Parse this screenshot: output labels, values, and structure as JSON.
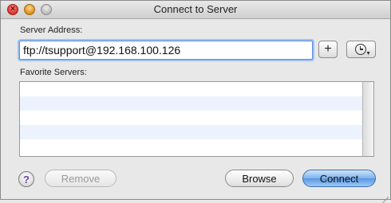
{
  "window": {
    "title": "Connect to Server"
  },
  "server_address": {
    "label": "Server Address:",
    "value": "ftp://tsupport@192.168.100.126"
  },
  "buttons": {
    "add": "+",
    "recent": "recent-servers-clock-icon",
    "help": "?",
    "remove": "Remove",
    "browse": "Browse",
    "connect": "Connect"
  },
  "favorites": {
    "label": "Favorite Servers:",
    "items": []
  },
  "colors": {
    "selection_focus": "#9cc2f0",
    "list_alternate_row": "#edf3fe",
    "default_button": "#5a97e2"
  }
}
